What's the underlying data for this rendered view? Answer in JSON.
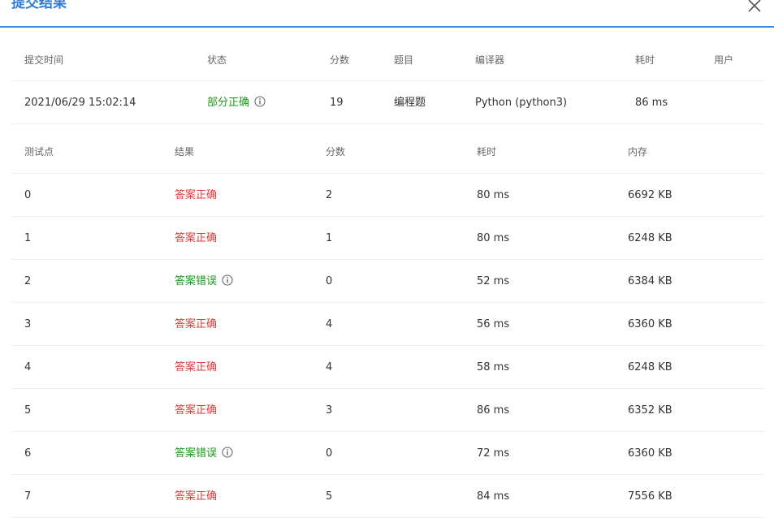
{
  "dialog": {
    "title": "提交结果",
    "close_icon": "close-icon"
  },
  "summary": {
    "headers": [
      "提交时间",
      "状态",
      "分数",
      "题目",
      "编译器",
      "耗时",
      "用户"
    ],
    "row": {
      "time": "2021/06/29 15:02:14",
      "status": "部分正确",
      "score": "19",
      "problem": "编程题",
      "compiler": "Python (python3)",
      "duration": "86 ms",
      "user": ""
    }
  },
  "cases": {
    "headers": [
      "测试点",
      "结果",
      "分数",
      "耗时",
      "内存"
    ],
    "rows": [
      {
        "id": "0",
        "result": "答案正确",
        "score": "2",
        "time": "80 ms",
        "memory": "6692 KB"
      },
      {
        "id": "1",
        "result": "答案正确",
        "score": "1",
        "time": "80 ms",
        "memory": "6248 KB"
      },
      {
        "id": "2",
        "result": "答案错误",
        "score": "0",
        "time": "52 ms",
        "memory": "6384 KB"
      },
      {
        "id": "3",
        "result": "答案正确",
        "score": "4",
        "time": "56 ms",
        "memory": "6360 KB"
      },
      {
        "id": "4",
        "result": "答案正确",
        "score": "4",
        "time": "58 ms",
        "memory": "6248 KB"
      },
      {
        "id": "5",
        "result": "答案正确",
        "score": "3",
        "time": "86 ms",
        "memory": "6352 KB"
      },
      {
        "id": "6",
        "result": "答案错误",
        "score": "0",
        "time": "72 ms",
        "memory": "6360 KB"
      },
      {
        "id": "7",
        "result": "答案正确",
        "score": "5",
        "time": "84 ms",
        "memory": "7556 KB"
      }
    ]
  },
  "colors": {
    "accent": "#2e7cd1",
    "correct": "#e03a3a",
    "wrong": "#1a9a1a",
    "partial": "#1a9a1a"
  },
  "icons": {
    "info": "info-icon"
  }
}
